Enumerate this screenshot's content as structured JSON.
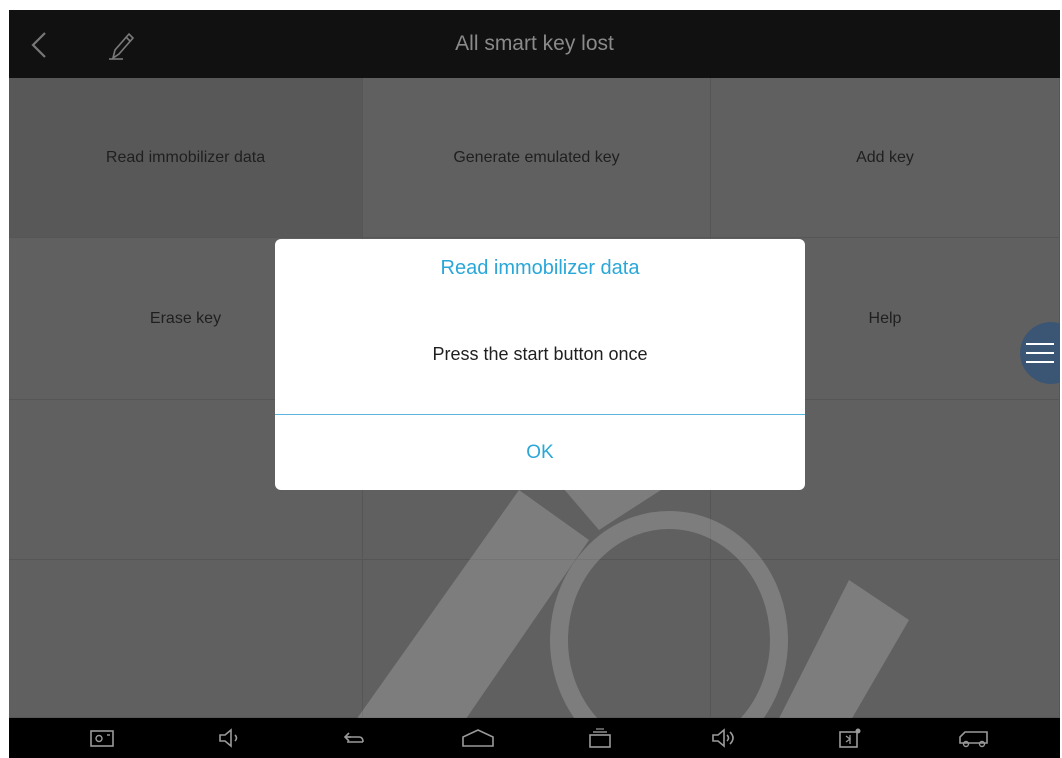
{
  "header": {
    "title": "All smart key lost",
    "back_icon": "back-chevron-icon",
    "edit_icon": "pen-icon"
  },
  "grid": {
    "cells": [
      {
        "label": "Read immobilizer data"
      },
      {
        "label": "Generate emulated key"
      },
      {
        "label": "Add key"
      },
      {
        "label": "Erase key"
      },
      {
        "label": ""
      },
      {
        "label": "Help"
      },
      {
        "label": ""
      },
      {
        "label": ""
      },
      {
        "label": ""
      },
      {
        "label": ""
      },
      {
        "label": ""
      },
      {
        "label": ""
      }
    ]
  },
  "dialog": {
    "title": "Read immobilizer data",
    "message": "Press the start button once",
    "ok_label": "OK"
  },
  "navbar": {
    "icons": [
      "screenshot-icon",
      "volume-down-icon",
      "back-arrow-icon",
      "home-icon",
      "recent-apps-icon",
      "volume-up-icon",
      "vci-connection-icon",
      "car-icon"
    ]
  },
  "colors": {
    "accent": "#2aa7d8",
    "fab": "#3b5674",
    "background": "#5f5f5f",
    "header": "#111111"
  }
}
